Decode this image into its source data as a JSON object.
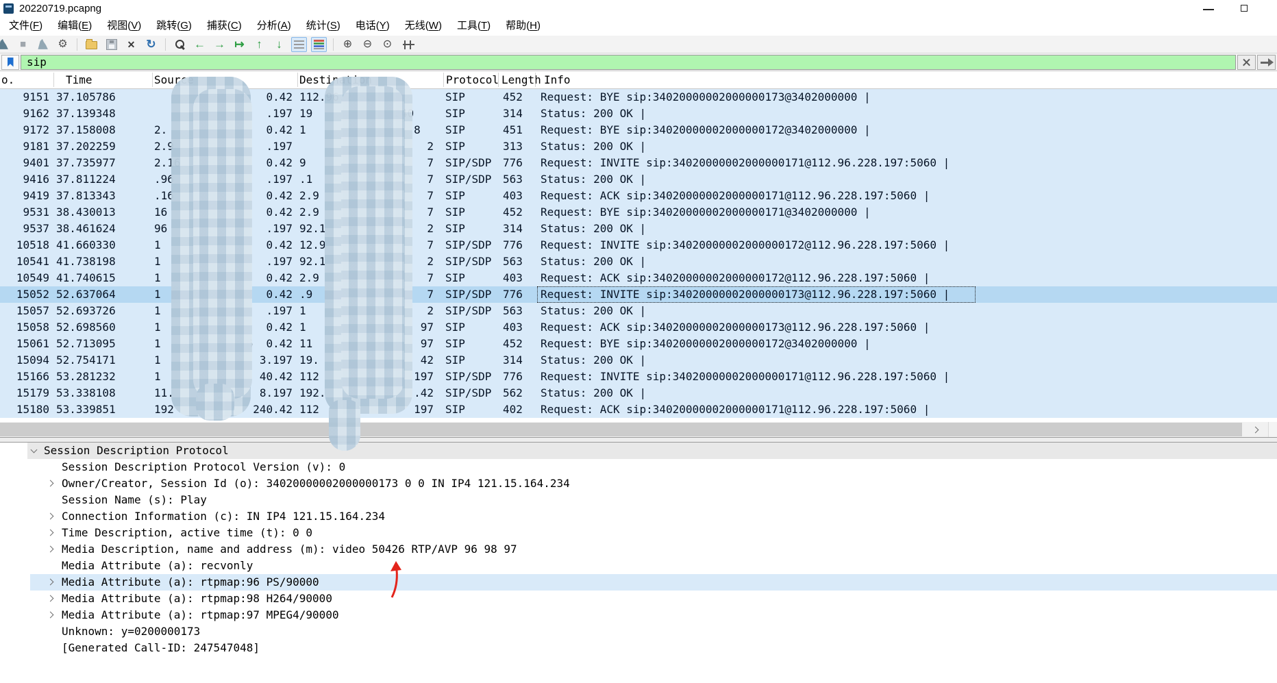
{
  "window": {
    "title": "20220719.pcapng"
  },
  "menu": {
    "items": [
      "文件(F)",
      "编辑(E)",
      "视图(V)",
      "跳转(G)",
      "捕获(C)",
      "分析(A)",
      "统计(S)",
      "电话(Y)",
      "无线(W)",
      "工具(T)",
      "帮助(H)"
    ]
  },
  "toolbar": {
    "icons": [
      {
        "name": "capture-start-icon",
        "type": "fin"
      },
      {
        "name": "capture-stop-icon",
        "type": "glyph",
        "glyph": "■"
      },
      {
        "name": "capture-restart-icon",
        "type": "fin2"
      },
      {
        "name": "capture-options-icon",
        "type": "glyph",
        "glyph": "⚙"
      },
      {
        "name": "separator",
        "type": "sep"
      },
      {
        "name": "open-file-icon",
        "type": "folder"
      },
      {
        "name": "save-file-icon",
        "type": "floppy"
      },
      {
        "name": "close-file-icon",
        "type": "glyph",
        "glyph": "✕"
      },
      {
        "name": "reload-file-icon",
        "type": "glyph",
        "glyph": "↻"
      },
      {
        "name": "separator",
        "type": "sep"
      },
      {
        "name": "find-packet-icon",
        "type": "mag"
      },
      {
        "name": "go-back-icon",
        "type": "glyph",
        "glyph": "←"
      },
      {
        "name": "go-forward-icon",
        "type": "glyph",
        "glyph": "→"
      },
      {
        "name": "go-to-packet-icon",
        "type": "glyph",
        "glyph": "↦"
      },
      {
        "name": "go-first-icon",
        "type": "glyph",
        "glyph": "↑"
      },
      {
        "name": "go-last-icon",
        "type": "glyph",
        "glyph": "↓"
      },
      {
        "name": "auto-scroll-icon",
        "type": "lines",
        "pressed": true
      },
      {
        "name": "colorize-icon",
        "type": "linesc",
        "pressed": true
      },
      {
        "name": "separator",
        "type": "sep"
      },
      {
        "name": "zoom-in-icon",
        "type": "glyph",
        "glyph": "⊕"
      },
      {
        "name": "zoom-out-icon",
        "type": "glyph",
        "glyph": "⊖"
      },
      {
        "name": "zoom-reset-icon",
        "type": "glyph",
        "glyph": "⊙"
      },
      {
        "name": "resize-columns-icon",
        "type": "cols"
      }
    ]
  },
  "filter": {
    "value": "sip"
  },
  "packet_list": {
    "columns": [
      "o.",
      "Time",
      "Source",
      "Destination",
      "Protocol",
      "Length",
      "Info"
    ],
    "rows": [
      {
        "no": "9151",
        "time": "37.105786",
        "sl": "",
        "sr": "6   0.42",
        "dl": "112.96.228.",
        "dr": "",
        "proto": "SIP",
        "len": "452",
        "info": "Request: BYE sip:34020000002000000173@3402000000 |"
      },
      {
        "no": "9162",
        "time": "37.139348",
        "sl": "",
        "sr": ".197",
        "dl": "19",
        "dr": "240   ",
        "proto": "SIP",
        "len": "314",
        "info": "Status: 200 OK |"
      },
      {
        "no": "9172",
        "time": "37.158008",
        "sl": "2.",
        "sr": "0.42",
        "dl": "1",
        "dr": "8  ",
        "proto": "SIP",
        "len": "451",
        "info": "Request: BYE sip:34020000002000000172@3402000000 |"
      },
      {
        "no": "9181",
        "time": "37.202259",
        "sl": "2.9",
        "sr": ".197",
        "dl": "",
        "dr": "2",
        "proto": "SIP",
        "len": "313",
        "info": "Status: 200 OK |"
      },
      {
        "no": "9401",
        "time": "37.735977",
        "sl": "2.16",
        "sr": "0.42",
        "dl": "9",
        "dr": "7",
        "proto": "SIP/SDP",
        "len": "776",
        "info": "Request: INVITE sip:34020000002000000171@112.96.228.197:5060 |"
      },
      {
        "no": "9416",
        "time": "37.811224",
        "sl": ".96",
        "sr": ".197",
        "dl": ".1",
        "dr": "7",
        "proto": "SIP/SDP",
        "len": "563",
        "info": "Status: 200 OK |"
      },
      {
        "no": "9419",
        "time": "37.813343",
        "sl": ".16",
        "sr": "0.42",
        "dl": "2.9",
        "dr": "7",
        "proto": "SIP",
        "len": "403",
        "info": "Request: ACK sip:34020000002000000171@112.96.228.197:5060 |"
      },
      {
        "no": "9531",
        "time": "38.430013",
        "sl": "16",
        "sr": "0.42",
        "dl": "2.9",
        "dr": "7",
        "proto": "SIP",
        "len": "452",
        "info": "Request: BYE sip:34020000002000000171@3402000000 |"
      },
      {
        "no": "9537",
        "time": "38.461624",
        "sl": "96",
        "sr": ".197",
        "dl": "92.1",
        "dr": "2",
        "proto": "SIP",
        "len": "314",
        "info": "Status: 200 OK |"
      },
      {
        "no": "10518",
        "time": "41.660330",
        "sl": "1",
        "sr": "0.42",
        "dl": "12.9",
        "dr": "7",
        "proto": "SIP/SDP",
        "len": "776",
        "info": "Request: INVITE sip:34020000002000000172@112.96.228.197:5060 |"
      },
      {
        "no": "10541",
        "time": "41.738198",
        "sl": "1",
        "sr": ".197",
        "dl": "92.1",
        "dr": "2",
        "proto": "SIP/SDP",
        "len": "563",
        "info": "Status: 200 OK |"
      },
      {
        "no": "10549",
        "time": "41.740615",
        "sl": "1",
        "sr": "0.42",
        "dl": "2.9",
        "dr": "7",
        "proto": "SIP",
        "len": "403",
        "info": "Request: ACK sip:34020000002000000172@112.96.228.197:5060 |"
      },
      {
        "no": "15052",
        "time": "52.637064",
        "sl": "1",
        "sr": "0.42",
        "dl": ".9",
        "dr": "7",
        "proto": "SIP/SDP",
        "len": "776",
        "info": "Request: INVITE sip:34020000002000000173@112.96.228.197:5060 |",
        "selected": true
      },
      {
        "no": "15057",
        "time": "52.693726",
        "sl": "1",
        "sr": ".197",
        "dl": "1",
        "dr": "2",
        "proto": "SIP/SDP",
        "len": "563",
        "info": "Status: 200 OK |"
      },
      {
        "no": "15058",
        "time": "52.698560",
        "sl": "1",
        "sr": "0.42",
        "dl": "1",
        "dr": "97",
        "proto": "SIP",
        "len": "403",
        "info": "Request: ACK sip:34020000002000000173@112.96.228.197:5060 |"
      },
      {
        "no": "15061",
        "time": "52.713095",
        "sl": "1",
        "sr": "6  0.42",
        "dl": "11",
        "dr": "97",
        "proto": "SIP",
        "len": "452",
        "info": "Request: BYE sip:34020000002000000172@3402000000 |"
      },
      {
        "no": "15094",
        "time": "52.754171",
        "sl": "1",
        "sr": "3.197",
        "dl": "19.",
        "dr": "42",
        "proto": "SIP",
        "len": "314",
        "info": "Status: 200 OK |"
      },
      {
        "no": "15166",
        "time": "53.281232",
        "sl": "1",
        "sr": "40.42",
        "dl": "112",
        "dr": "197",
        "proto": "SIP/SDP",
        "len": "776",
        "info": "Request: INVITE sip:34020000002000000171@112.96.228.197:5060 |"
      },
      {
        "no": "15179",
        "time": "53.338108",
        "sl": "11.",
        "sr": "8.197",
        "dl": "192.",
        "dr": ".42",
        "proto": "SIP/SDP",
        "len": "562",
        "info": "Status: 200 OK |"
      },
      {
        "no": "15180",
        "time": "53.339851",
        "sl": "192",
        "sr": "240.42",
        "dl": "112",
        "dr": "197",
        "proto": "SIP",
        "len": "402",
        "info": "Request: ACK sip:34020000002000000171@112.96.228.197:5060 |"
      }
    ]
  },
  "details": {
    "rows": [
      {
        "indent": 0,
        "chev": "down",
        "text": "Session Description Protocol",
        "bg": "gray"
      },
      {
        "indent": 1,
        "chev": null,
        "text": "Session Description Protocol Version (v): 0"
      },
      {
        "indent": 1,
        "chev": "right",
        "text": "Owner/Creator, Session Id (o): 34020000002000000173 0 0 IN IP4 121.15.164.234"
      },
      {
        "indent": 1,
        "chev": null,
        "text": "Session Name (s): Play"
      },
      {
        "indent": 1,
        "chev": "right",
        "text": "Connection Information (c): IN IP4 121.15.164.234"
      },
      {
        "indent": 1,
        "chev": "right",
        "text": "Time Description, active time (t): 0 0"
      },
      {
        "indent": 1,
        "chev": "right",
        "text": "Media Description, name and address (m): video 50426 RTP/AVP 96 98 97"
      },
      {
        "indent": 1,
        "chev": null,
        "text": "Media Attribute (a): recvonly"
      },
      {
        "indent": 1,
        "chev": "right",
        "text": "Media Attribute (a): rtpmap:96 PS/90000",
        "bg": "blue"
      },
      {
        "indent": 1,
        "chev": "right",
        "text": "Media Attribute (a): rtpmap:98 H264/90000"
      },
      {
        "indent": 1,
        "chev": "right",
        "text": "Media Attribute (a): rtpmap:97 MPEG4/90000"
      },
      {
        "indent": 1,
        "chev": null,
        "text": "Unknown: y=0200000173"
      },
      {
        "indent": 1,
        "chev": null,
        "text": "[Generated Call-ID: 247547048]"
      }
    ]
  },
  "annotation": {
    "points_to": "50426"
  },
  "colors": {
    "filter_valid_bg": "#b0f5b0",
    "row_bg": "#d9eaf9",
    "row_selected_bg": "#b5d8f2",
    "redaction_mosaic": "#d4e2ec",
    "details_selected_bg": "#e8e8e8",
    "details_highlight_bg": "#d9eaf9",
    "annotation_red": "#e3241b",
    "nav_green": "#2f9e44"
  }
}
